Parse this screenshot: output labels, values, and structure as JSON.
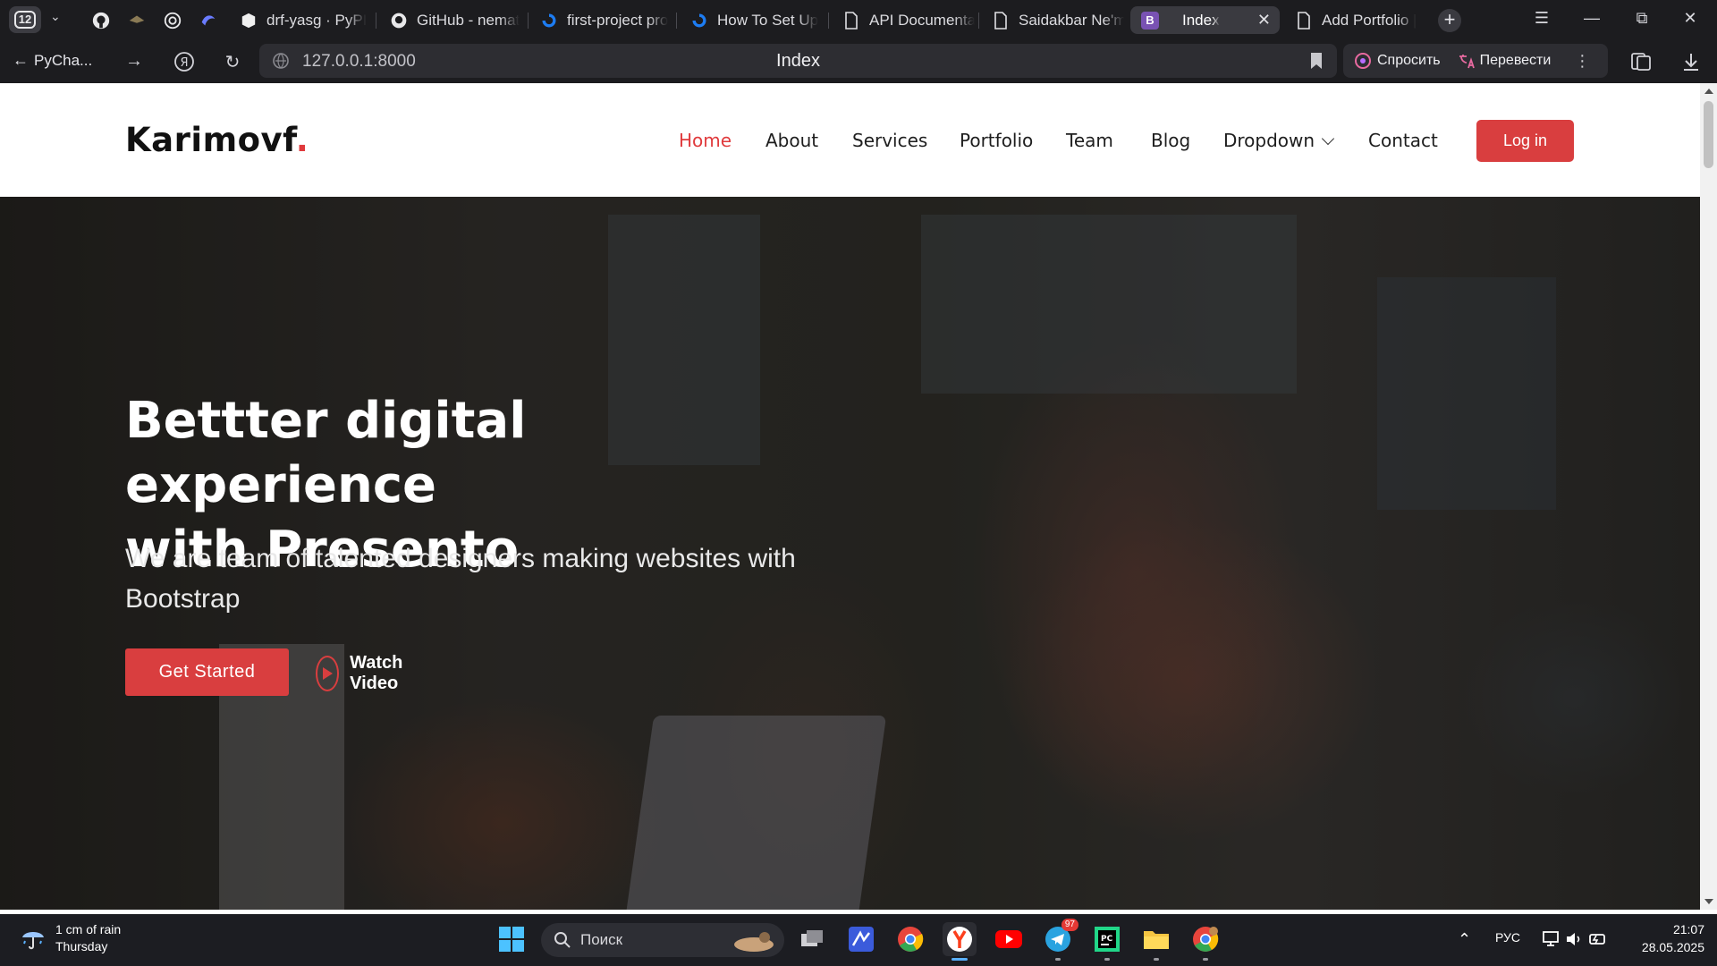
{
  "browser": {
    "tab_count": "12",
    "tabs": [
      {
        "title": "drf-yasg · PyPI"
      },
      {
        "title": "GitHub - nemat"
      },
      {
        "title": "first-project pro"
      },
      {
        "title": "How To Set Up"
      },
      {
        "title": "API Documenta"
      },
      {
        "title": "Saidakbar Ne'm"
      },
      {
        "title": "Index",
        "favicon_letter": "B"
      },
      {
        "title": "Add Portfolio | "
      }
    ],
    "back_label": "PyCha...",
    "url": "127.0.0.1:8000",
    "page_title": "Index",
    "ask_label": "Спросить",
    "translate_label": "Перевести"
  },
  "site": {
    "logo_text": "Karimovf",
    "logo_dot": ".",
    "nav": {
      "home": "Home",
      "about": "About",
      "services": "Services",
      "portfolio": "Portfolio",
      "team": "Team",
      "blog": "Blog",
      "dropdown": "Dropdown",
      "contact": "Contact"
    },
    "login_label": "Log in",
    "hero": {
      "title_line1": "Bettter digital experience",
      "title_line2": "with Presento",
      "subtitle": "We are team of talented designers making websites with Bootstrap",
      "cta_label": "Get Started",
      "video_label": "Watch Video"
    }
  },
  "taskbar": {
    "weather_line1": "1 cm of rain",
    "weather_line2": "Thursday",
    "search_placeholder": "Поиск",
    "telegram_badge": "97",
    "language": "РУС",
    "time": "21:07",
    "date": "28.05.2025"
  },
  "colors": {
    "accent": "#d93e3f",
    "nav_active": "#e03a3c",
    "browser_chrome": "#1c1c1f",
    "taskbar": "#1c1d22"
  }
}
